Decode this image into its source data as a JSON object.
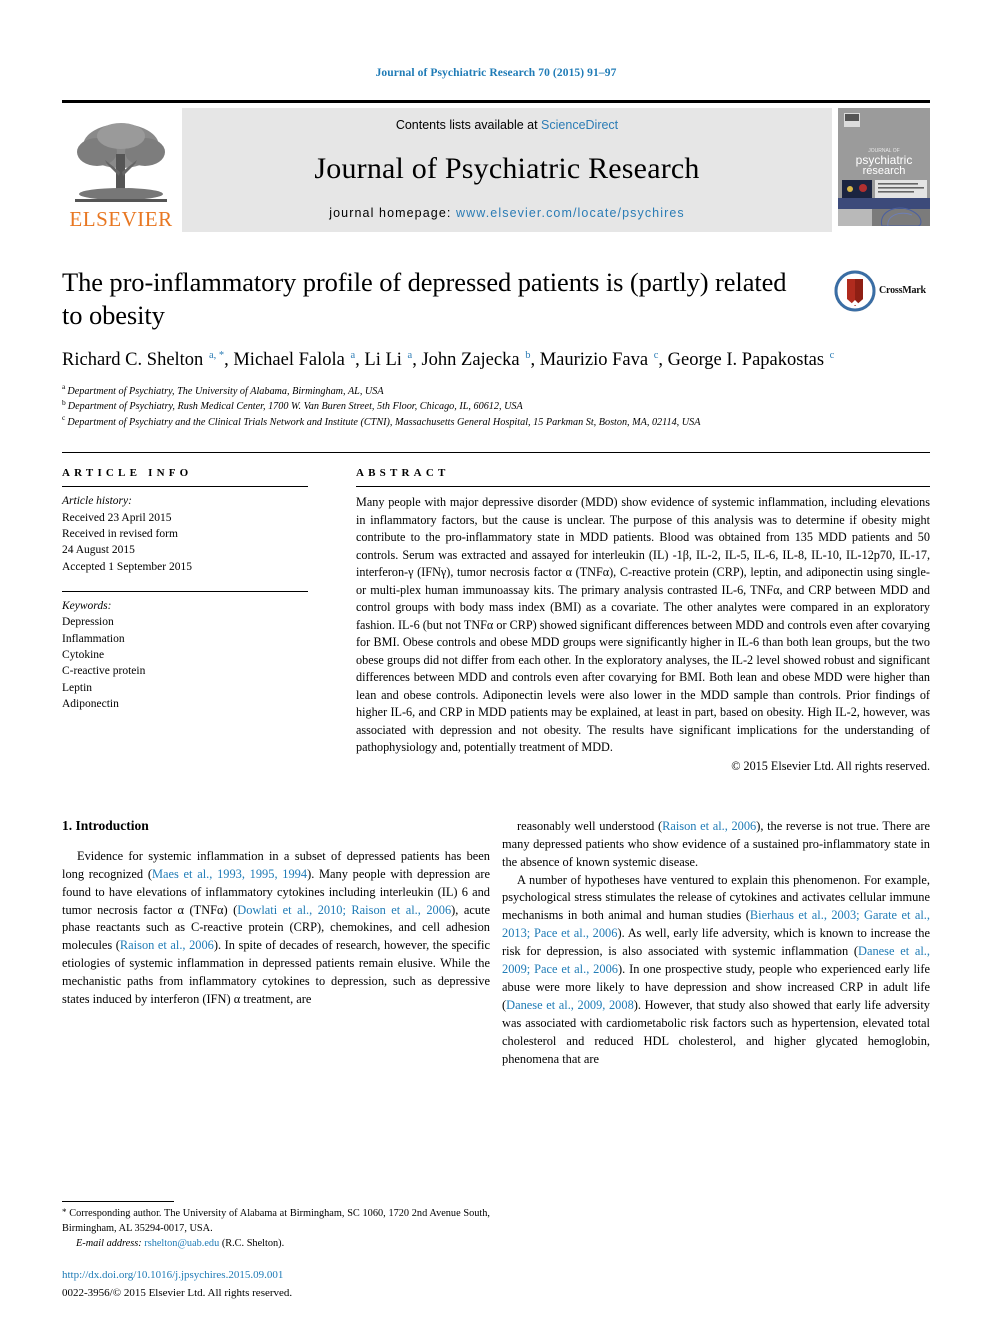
{
  "running_head": "Journal of Psychiatric Research 70 (2015) 91–97",
  "masthead": {
    "contents_prefix": "Contents lists available at ",
    "contents_link": "ScienceDirect",
    "journal_title": "Journal of Psychiatric Research",
    "homepage_prefix": "journal homepage: ",
    "homepage_url": "www.elsevier.com/locate/psychires",
    "publisher_name": "ELSEVIER",
    "cover_title_line1": "psychiatric",
    "cover_title_line2": "research",
    "band_color": "#e6e6e6",
    "link_color": "#2b7cb5",
    "publisher_color": "#e87722"
  },
  "article": {
    "title": "The pro-inflammatory profile of depressed patients is (partly) related to obesity",
    "crossmark_label": "CrossMark",
    "authors_html": "Richard C. Shelton <sup>a, *</sup>, Michael Falola <sup>a</sup>, Li Li <sup>a</sup>, John Zajecka <sup>b</sup>, Maurizio Fava <sup>c</sup>, George I. Papakostas <sup>c</sup>",
    "affiliations": [
      {
        "marker": "a",
        "text": "Department of Psychiatry, The University of Alabama, Birmingham, AL, USA"
      },
      {
        "marker": "b",
        "text": "Department of Psychiatry, Rush Medical Center, 1700 W. Van Buren Street, 5th Floor, Chicago, IL, 60612, USA"
      },
      {
        "marker": "c",
        "text": "Department of Psychiatry and the Clinical Trials Network and Institute (CTNI), Massachusetts General Hospital, 15 Parkman St, Boston, MA, 02114, USA"
      }
    ]
  },
  "article_info": {
    "heading": "ARTICLE INFO",
    "history_label": "Article history:",
    "history_lines": [
      "Received 23 April 2015",
      "Received in revised form",
      "24 August 2015",
      "Accepted 1 September 2015"
    ],
    "keywords_label": "Keywords:",
    "keywords": [
      "Depression",
      "Inflammation",
      "Cytokine",
      "C-reactive protein",
      "Leptin",
      "Adiponectin"
    ]
  },
  "abstract": {
    "heading": "ABSTRACT",
    "text": "Many people with major depressive disorder (MDD) show evidence of systemic inflammation, including elevations in inflammatory factors, but the cause is unclear. The purpose of this analysis was to determine if obesity might contribute to the pro-inflammatory state in MDD patients. Blood was obtained from 135 MDD patients and 50 controls. Serum was extracted and assayed for interleukin (IL) -1β, IL-2, IL-5, IL-6, IL-8, IL-10, IL-12p70, IL-17, interferon-γ (IFNγ), tumor necrosis factor α (TNFα), C-reactive protein (CRP), leptin, and adiponectin using single- or multi-plex human immunoassay kits. The primary analysis contrasted IL-6, TNFα, and CRP between MDD and control groups with body mass index (BMI) as a covariate. The other analytes were compared in an exploratory fashion. IL-6 (but not TNFα or CRP) showed significant differences between MDD and controls even after covarying for BMI. Obese controls and obese MDD groups were significantly higher in IL-6 than both lean groups, but the two obese groups did not differ from each other. In the exploratory analyses, the IL-2 level showed robust and significant differences between MDD and controls even after covarying for BMI. Both lean and obese MDD were higher than lean and obese controls. Adiponectin levels were also lower in the MDD sample than controls. Prior findings of higher IL-6, and CRP in MDD patients may be explained, at least in part, based on obesity. High IL-2, however, was associated with depression and not obesity. The results have significant implications for the understanding of pathophysiology and, potentially treatment of MDD.",
    "copyright": "© 2015 Elsevier Ltd. All rights reserved."
  },
  "introduction": {
    "heading": "1. Introduction",
    "left_paragraph_parts": [
      {
        "t": "Evidence for systemic inflammation in a subset of depressed patients has been long recognized (",
        "c": false
      },
      {
        "t": "Maes et al., 1993, 1995, 1994",
        "c": true
      },
      {
        "t": "). Many people with depression are found to have elevations of inflammatory cytokines including interleukin (IL) 6 and tumor necrosis factor α (TNFα) (",
        "c": false
      },
      {
        "t": "Dowlati et al., 2010; Raison et al., 2006",
        "c": true
      },
      {
        "t": "), acute phase reactants such as C-reactive protein (CRP), chemokines, and cell adhesion molecules (",
        "c": false
      },
      {
        "t": "Raison et al., 2006",
        "c": true
      },
      {
        "t": "). In spite of decades of research, however, the specific etiologies of systemic inflammation in depressed patients remain elusive. While the mechanistic paths from inflammatory cytokines to depression, such as depressive states induced by interferon (IFN) α treatment, are",
        "c": false
      }
    ],
    "right_paragraph1_parts": [
      {
        "t": "reasonably well understood (",
        "c": false
      },
      {
        "t": "Raison et al., 2006",
        "c": true
      },
      {
        "t": "), the reverse is not true. There are many depressed patients who show evidence of a sustained pro-inflammatory state in the absence of known systemic disease.",
        "c": false
      }
    ],
    "right_paragraph2_parts": [
      {
        "t": "A number of hypotheses have ventured to explain this phenomenon. For example, psychological stress stimulates the release of cytokines and activates cellular immune mechanisms in both animal and human studies (",
        "c": false
      },
      {
        "t": "Bierhaus et al., 2003; Garate et al., 2013; Pace et al., 2006",
        "c": true
      },
      {
        "t": "). As well, early life adversity, which is known to increase the risk for depression, is also associated with systemic inflammation (",
        "c": false
      },
      {
        "t": "Danese et al., 2009; Pace et al., 2006",
        "c": true
      },
      {
        "t": "). In one prospective study, people who experienced early life abuse were more likely to have depression and show increased CRP in adult life (",
        "c": false
      },
      {
        "t": "Danese et al., 2009, 2008",
        "c": true
      },
      {
        "t": "). However, that study also showed that early life adversity was associated with cardiometabolic risk factors such as hypertension, elevated total cholesterol and reduced HDL cholesterol, and higher glycated hemoglobin, phenomena that are",
        "c": false
      }
    ]
  },
  "footer": {
    "corresponding_marker": "*",
    "corresponding_text": "Corresponding author. The University of Alabama at Birmingham, SC 1060, 1720 2nd Avenue South, Birmingham, AL 35294-0017, USA.",
    "email_label": "E-mail address:",
    "email": "rshelton@uab.edu",
    "email_owner": "(R.C. Shelton).",
    "doi": "http://dx.doi.org/10.1016/j.jpsychires.2015.09.001",
    "issn_line": "0022-3956/© 2015 Elsevier Ltd. All rights reserved."
  }
}
